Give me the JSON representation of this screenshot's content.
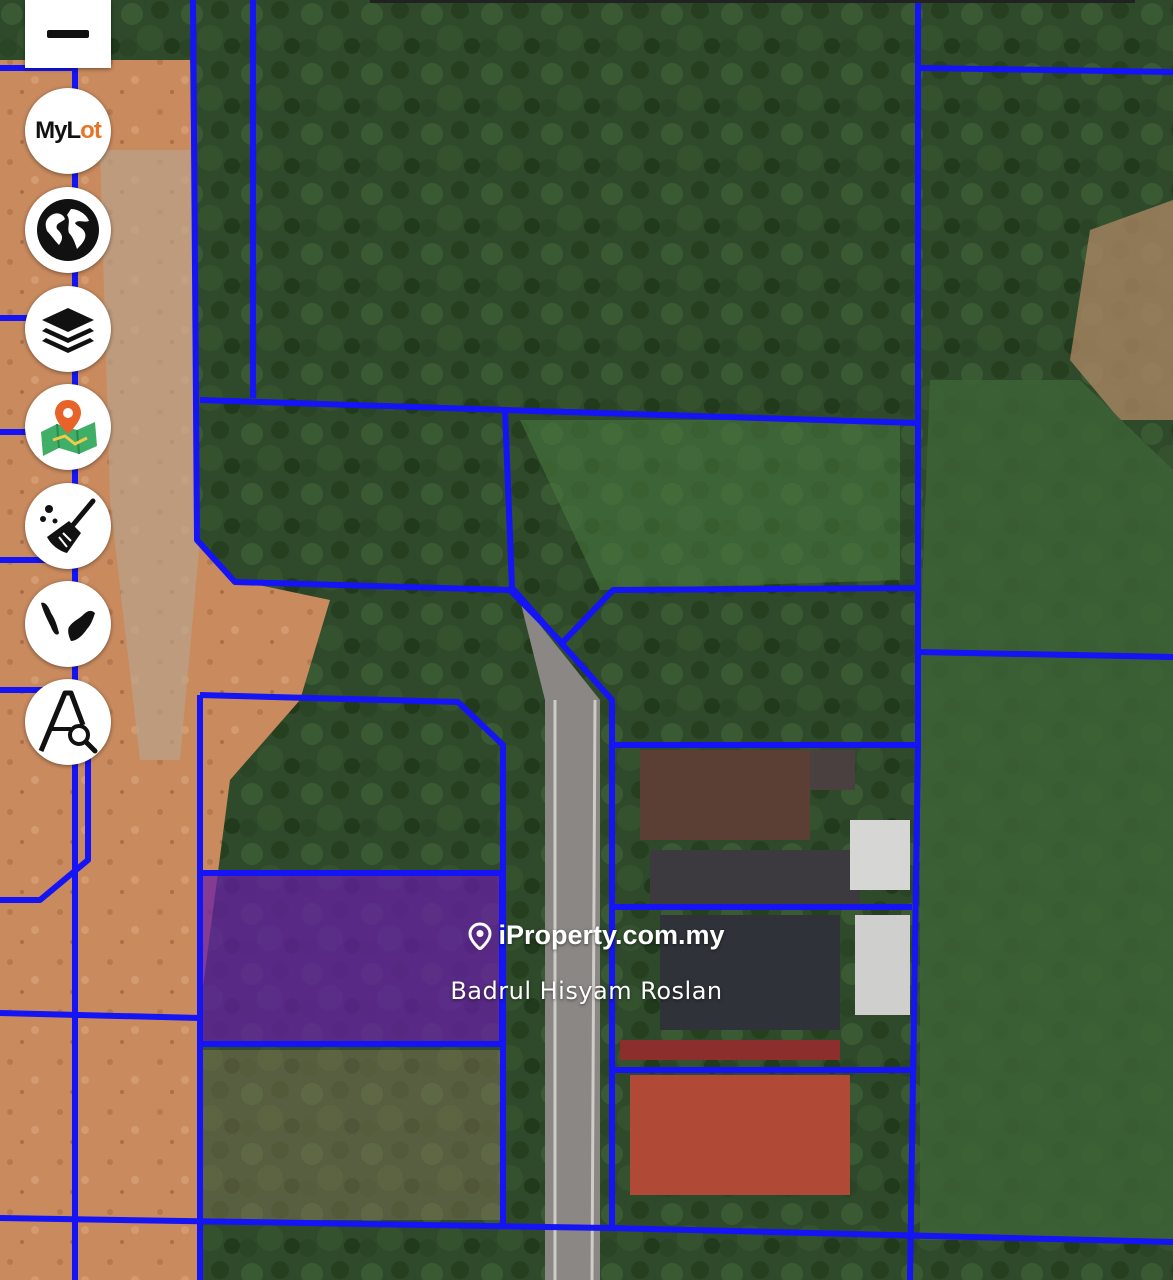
{
  "map": {
    "colors": {
      "lot_boundary": "#1414f5",
      "selected_lot_fill": "#6a1fa8",
      "forest": "#2f4a2a",
      "bare_soil": "#c98a5e",
      "road": "#8a8784"
    }
  },
  "controls": {
    "zoom_out": {
      "icon": "minus-icon"
    },
    "mylot": {
      "label_main": "My",
      "label_l": "L",
      "label_accent": "ot",
      "icon": "mylot-logo"
    },
    "basemap": {
      "icon": "globe-icon"
    },
    "layers": {
      "icon": "layers-icon"
    },
    "location": {
      "icon": "map-pin-icon"
    },
    "clear": {
      "icon": "broom-icon"
    },
    "malaysia": {
      "icon": "malaysia-map-icon"
    },
    "search": {
      "icon": "search-lot-icon"
    }
  },
  "watermark": {
    "brand": "iProperty.com.my",
    "agent": "Badrul Hisyam Roslan",
    "icon": "location-pin-icon"
  }
}
